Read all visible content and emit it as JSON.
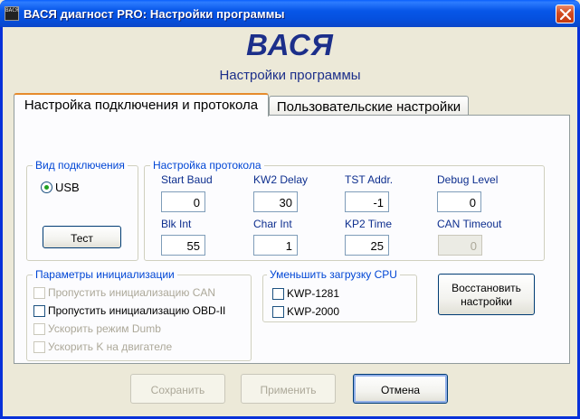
{
  "window": {
    "title": "ВАСЯ диагност PRO:  Настройки программы",
    "icon_name": "app-icon",
    "icon_text": "ВАСЯ"
  },
  "header": {
    "brand": "ВАСЯ",
    "subtitle": "Настройки программы"
  },
  "tabs": [
    {
      "label": "Настройка подключения и протокола",
      "active": true
    },
    {
      "label": "Пользовательские настройки",
      "active": false
    }
  ],
  "connection": {
    "title": "Вид подключения",
    "radio_label": "USB",
    "test_button": "Тест"
  },
  "protocol": {
    "title": "Настройка протокола",
    "fields": [
      {
        "label": "Start Baud",
        "value": "0",
        "enabled": true
      },
      {
        "label": "KW2 Delay",
        "value": "30",
        "enabled": true
      },
      {
        "label": "TST Addr.",
        "value": "-1",
        "enabled": true
      },
      {
        "label": "Debug Level",
        "value": "0",
        "enabled": true
      },
      {
        "label": "Blk Int",
        "value": "55",
        "enabled": true
      },
      {
        "label": "Char Int",
        "value": "1",
        "enabled": true
      },
      {
        "label": "KP2 Time",
        "value": "25",
        "enabled": true
      },
      {
        "label": "CAN Timeout",
        "value": "0",
        "enabled": false
      }
    ]
  },
  "init": {
    "title": "Параметры инициализации",
    "options": [
      {
        "label": "Пропустить инициализацию CAN",
        "checked": false,
        "enabled": false
      },
      {
        "label": "Пропустить инициализацию OBD-II",
        "checked": false,
        "enabled": true
      },
      {
        "label": "Ускорить режим Dumb",
        "checked": false,
        "enabled": false
      },
      {
        "label": "Ускорить K на двигателе",
        "checked": false,
        "enabled": false
      }
    ]
  },
  "cpu": {
    "title": "Уменьшить загрузку CPU",
    "options": [
      {
        "label": "KWP-1281",
        "checked": false
      },
      {
        "label": "KWP-2000",
        "checked": false
      }
    ]
  },
  "restore_button": {
    "line1": "Восстановить",
    "line2": "настройки"
  },
  "footer": {
    "save": "Сохранить",
    "apply": "Применить",
    "cancel": "Отмена"
  },
  "colors": {
    "titlebar": "#0756e8",
    "brand": "#1c2f8a",
    "group_title": "#0046d5",
    "tab_accent": "#e68b2c"
  }
}
